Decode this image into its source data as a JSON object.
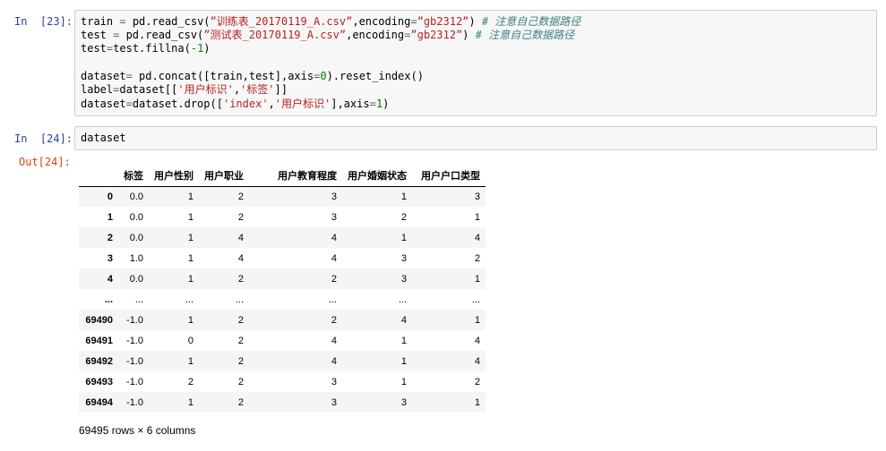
{
  "cells": [
    {
      "prompt": "In  [23]:",
      "lines": [
        [
          {
            "t": "train "
          },
          {
            "t": "=",
            "k": "op"
          },
          {
            "t": " pd.read_csv("
          },
          {
            "t": "”训练表_20170119_A.csv”",
            "k": "str"
          },
          {
            "t": ",encoding"
          },
          {
            "t": "=",
            "k": "op"
          },
          {
            "t": "”gb2312”",
            "k": "str"
          },
          {
            "t": ") "
          },
          {
            "t": "# 注意自己数据路径",
            "k": "com"
          }
        ],
        [
          {
            "t": "test "
          },
          {
            "t": "=",
            "k": "op"
          },
          {
            "t": " pd.read_csv("
          },
          {
            "t": "”测试表_20170119_A.csv”",
            "k": "str"
          },
          {
            "t": ",encoding"
          },
          {
            "t": "=",
            "k": "op"
          },
          {
            "t": "”gb2312”",
            "k": "str"
          },
          {
            "t": ") "
          },
          {
            "t": "# 注意自己数据路径",
            "k": "com"
          }
        ],
        [
          {
            "t": "test"
          },
          {
            "t": "=",
            "k": "op"
          },
          {
            "t": "test.fillna("
          },
          {
            "t": "-1",
            "k": "num"
          },
          {
            "t": ")"
          }
        ],
        [],
        [
          {
            "t": "dataset"
          },
          {
            "t": "=",
            "k": "op"
          },
          {
            "t": " pd.concat([train,test],axis"
          },
          {
            "t": "=",
            "k": "op"
          },
          {
            "t": "0",
            "k": "num"
          },
          {
            "t": ").reset_index()"
          }
        ],
        [
          {
            "t": "label"
          },
          {
            "t": "=",
            "k": "op"
          },
          {
            "t": "dataset[["
          },
          {
            "t": "'用户标识'",
            "k": "str"
          },
          {
            "t": ","
          },
          {
            "t": "'标签'",
            "k": "str"
          },
          {
            "t": "]]"
          }
        ],
        [
          {
            "t": "dataset"
          },
          {
            "t": "=",
            "k": "op"
          },
          {
            "t": "dataset.drop(["
          },
          {
            "t": "'index'",
            "k": "str"
          },
          {
            "t": ","
          },
          {
            "t": "'用户标识'",
            "k": "str"
          },
          {
            "t": "],axis"
          },
          {
            "t": "=",
            "k": "op"
          },
          {
            "t": "1",
            "k": "num"
          },
          {
            "t": ")"
          }
        ]
      ]
    },
    {
      "prompt": "In  [24]:",
      "lines": [
        [
          {
            "t": "dataset"
          }
        ]
      ]
    }
  ],
  "output": {
    "prompt": "Out[24]:",
    "columns": [
      "",
      "标签",
      "用户性别",
      "用户职业",
      "用户教育程度",
      "用户婚姻状态",
      "用户户口类型"
    ],
    "rows": [
      [
        "0",
        "0.0",
        "1",
        "2",
        "3",
        "1",
        "3"
      ],
      [
        "1",
        "0.0",
        "1",
        "2",
        "3",
        "2",
        "1"
      ],
      [
        "2",
        "0.0",
        "1",
        "4",
        "4",
        "1",
        "4"
      ],
      [
        "3",
        "1.0",
        "1",
        "4",
        "4",
        "3",
        "2"
      ],
      [
        "4",
        "0.0",
        "1",
        "2",
        "2",
        "3",
        "1"
      ],
      [
        "...",
        "...",
        "...",
        "...",
        "...",
        "...",
        "..."
      ],
      [
        "69490",
        "-1.0",
        "1",
        "2",
        "2",
        "4",
        "1"
      ],
      [
        "69491",
        "-1.0",
        "0",
        "2",
        "4",
        "1",
        "4"
      ],
      [
        "69492",
        "-1.0",
        "1",
        "2",
        "4",
        "1",
        "4"
      ],
      [
        "69493",
        "-1.0",
        "2",
        "2",
        "3",
        "1",
        "2"
      ],
      [
        "69494",
        "-1.0",
        "1",
        "2",
        "3",
        "3",
        "1"
      ]
    ],
    "summary": "69495 rows × 6 columns"
  },
  "colors": {
    "prompt_in": "#303f9f",
    "prompt_out": "#d84315",
    "string": "#ba2121",
    "comment": "#408080",
    "number": "#008000",
    "operator": "#666666",
    "code_background": "#f7f7f7",
    "code_border": "#cfcfcf",
    "table_stripe": "#f5f5f5"
  }
}
